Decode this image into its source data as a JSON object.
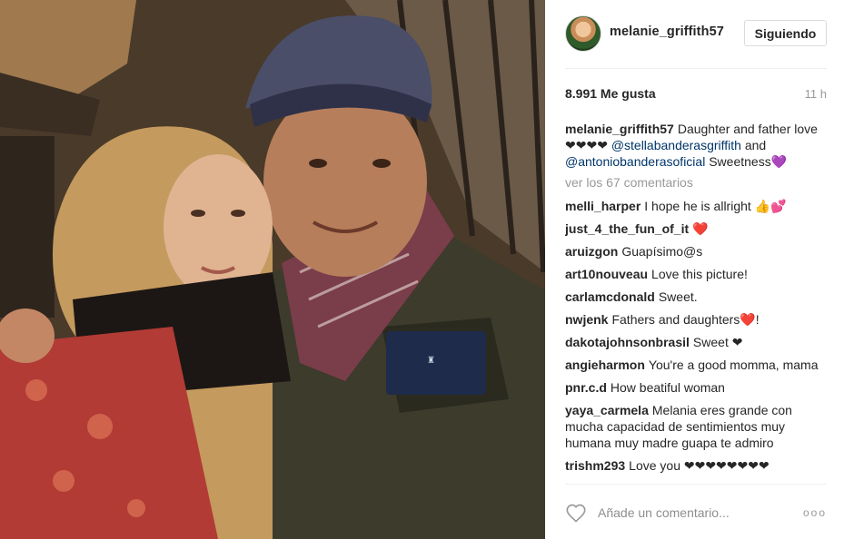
{
  "post": {
    "image_alt": "",
    "header": {
      "username": "melanie_griffith57",
      "follow_label": "Siguiendo"
    },
    "likes": "8.991 Me gusta",
    "time": "11 h",
    "caption": {
      "user": "melanie_griffith57",
      "text_1": "Daughter and father love❤❤❤❤",
      "mention_1": "@stellabanderasgriffith",
      "text_2": " and ",
      "mention_2": "@antoniobanderasoficial",
      "text_3": " Sweetness💜"
    },
    "view_more": "ver los 67 comentarios",
    "comments": [
      {
        "user": "melli_harper",
        "text": "I hope he is allright 👍💕"
      },
      {
        "user": "just_4_the_fun_of_it",
        "text": "❤️"
      },
      {
        "user": "aruizgon",
        "text": "Guapísimo@s"
      },
      {
        "user": "art10nouveau",
        "text": "Love this picture!"
      },
      {
        "user": "carlamcdonald",
        "text": "Sweet."
      },
      {
        "user": "nwjenk",
        "text": "Fathers and daughters❤️!"
      },
      {
        "user": "dakotajohnsonbrasil",
        "text": "Sweet ❤"
      },
      {
        "user": "angieharmon",
        "text": "You're a good momma, mama"
      },
      {
        "user": "pnr.c.d",
        "text": "How beatiful woman"
      },
      {
        "user": "yaya_carmela",
        "text": "Melania eres grande con mucha capacidad de sentimientos muy humana muy madre guapa te admiro"
      },
      {
        "user": "trishm293",
        "text": "Love you ❤❤❤❤❤❤❤❤"
      }
    ],
    "comment_placeholder": "Añade un comentario...",
    "more_icon": "ooo"
  },
  "icons": {
    "like": "heart-outline-icon",
    "more": "more-options-icon"
  }
}
